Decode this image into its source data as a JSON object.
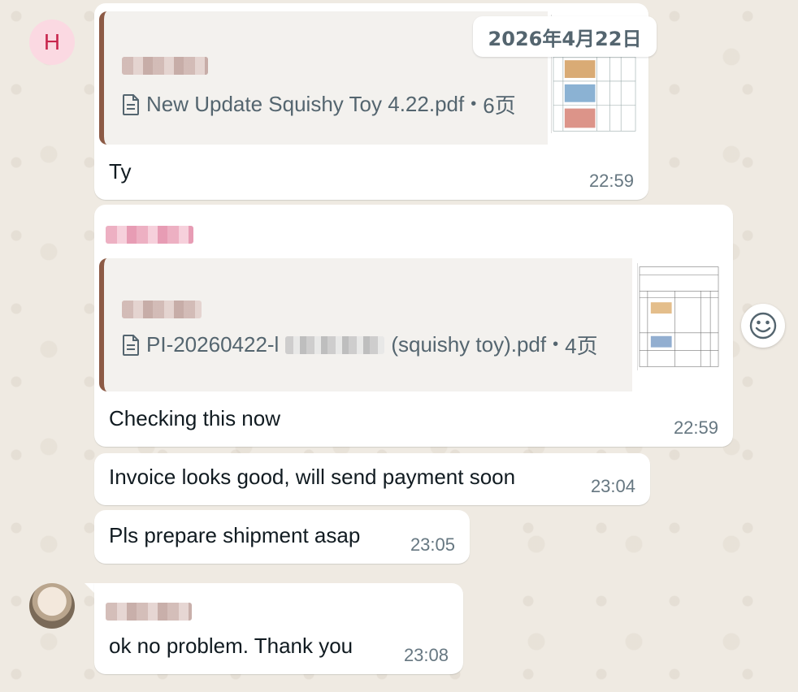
{
  "date_chip": "2026年4月22日",
  "contact_h": {
    "initial": "H"
  },
  "messages": [
    {
      "file": {
        "name": "New Update Squishy Toy 4.22.pdf",
        "pages": "6页",
        "sep": "•"
      },
      "text": "Ty",
      "time": "22:59"
    },
    {
      "file": {
        "name_prefix": "PI-20260422-l",
        "name_suffix": "(squishy toy).pdf",
        "pages": "4页",
        "sep": "•"
      },
      "text": "Checking this now",
      "time": "22:59"
    },
    {
      "text": "Invoice looks good, will send payment soon",
      "time": "23:04"
    },
    {
      "text": "Pls prepare shipment asap",
      "time": "23:05"
    },
    {
      "text": "ok no problem. Thank you",
      "time": "23:08"
    }
  ],
  "icons": {
    "emoji_button": "smiley-icon",
    "document": "document-icon"
  },
  "colors": {
    "wallpaper": "#efeae2",
    "bubble": "#ffffff",
    "quote_bar": "#8c5a45",
    "time": "#667781",
    "avatar_h_bg": "#fbd9e2",
    "avatar_h_fg": "#c8264d"
  }
}
